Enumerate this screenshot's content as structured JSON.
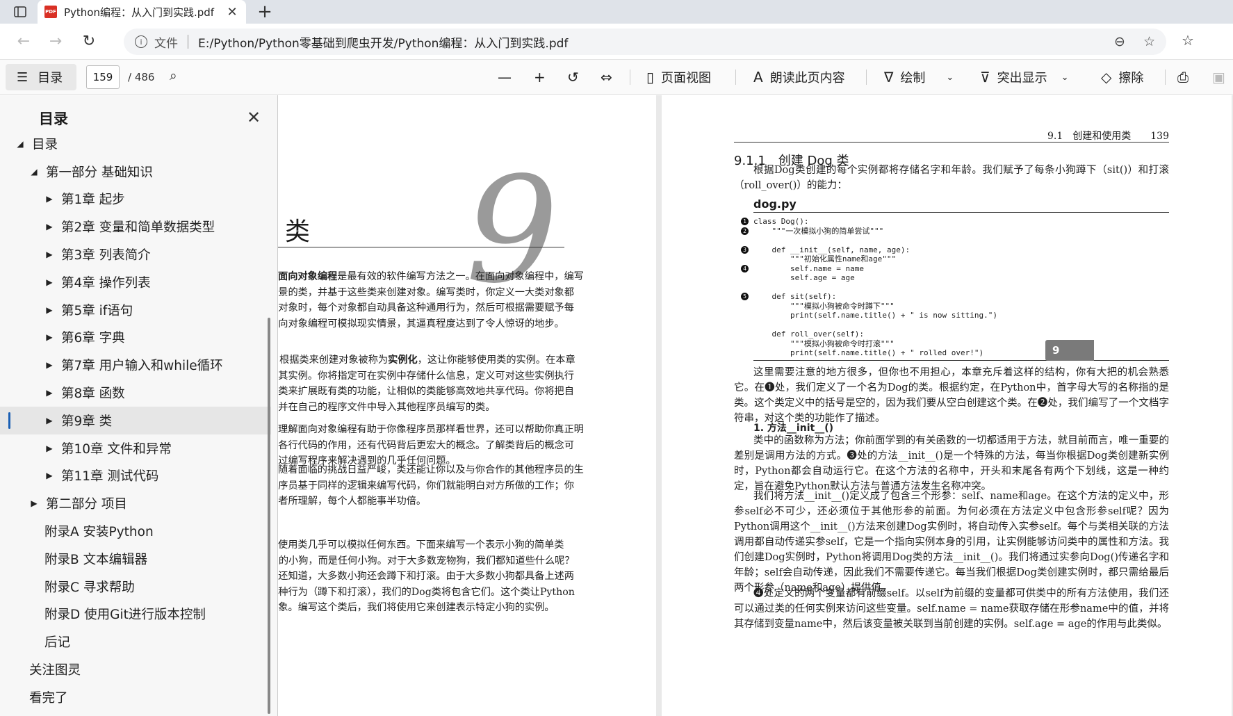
{
  "browser": {
    "tab_title": "Python编程：从入门到实践.pdf",
    "pdf_badge": "PDF",
    "scheme_label": "文件",
    "url": "E:/Python/Python零基础到爬虫开发/Python编程：从入门到实践.pdf"
  },
  "toolbar": {
    "toc_label": "目录",
    "page_current": "159",
    "page_total": "/ 486",
    "page_view_label": "页面视图",
    "read_aloud_label": "朗读此页内容",
    "draw_label": "绘制",
    "highlight_label": "突出显示",
    "erase_label": "擦除"
  },
  "sidebar": {
    "title": "目录",
    "items": [
      {
        "label": "目录",
        "tri": "◢"
      },
      {
        "label": "第一部分 基础知识",
        "tri": "◢"
      },
      {
        "label": "第1章 起步",
        "tri": "▶"
      },
      {
        "label": "第2章 变量和简单数据类型",
        "tri": "▶"
      },
      {
        "label": "第3章 列表简介",
        "tri": "▶"
      },
      {
        "label": "第4章 操作列表",
        "tri": "▶"
      },
      {
        "label": "第5章 if语句",
        "tri": "▶"
      },
      {
        "label": "第6章 字典",
        "tri": "▶"
      },
      {
        "label": "第7章 用户输入和while循环",
        "tri": "▶"
      },
      {
        "label": "第8章 函数",
        "tri": "▶"
      },
      {
        "label": "第9章 类",
        "tri": "▶"
      },
      {
        "label": "第10章 文件和异常",
        "tri": "▶"
      },
      {
        "label": "第11章 测试代码",
        "tri": "▶"
      },
      {
        "label": "第二部分 项目",
        "tri": "▶"
      },
      {
        "label": "附录A 安装Python",
        "tri": ""
      },
      {
        "label": "附录B 文本编辑器",
        "tri": ""
      },
      {
        "label": "附录C 寻求帮助",
        "tri": ""
      },
      {
        "label": "附录D 使用Git进行版本控制",
        "tri": ""
      },
      {
        "label": "后记",
        "tri": ""
      },
      {
        "label": "关注图灵",
        "tri": ""
      },
      {
        "label": "看完了",
        "tri": ""
      }
    ]
  },
  "left_page": {
    "chapter_number": "9",
    "chapter_title": "类",
    "para1_bold": "面向对象编程",
    "para1": "是最有效的软件编写方法之一。在面向对象编程中，编写表示现实世界中的事物和情景的类，并基于这些类来创建对象。编写类时，你定义一大类对象都有的通用行为。基于类创建对象时，每个对象都自动具备这种通用行为，然后可根据需要赋予每个对象独特的个性。使用面向对象编程可模拟现实情景，其逼真程度达到了令人惊讶的地步。",
    "para2_pre": "根据类来创建对象被称为",
    "para2_bold": "实例化",
    "para2": "，这让你能够使用类的实例。在本章中，你将编写一些类并创建其实例。你将指定可在实例中存储什么信息，定义可对这些实例执行哪些操作。你还将编写一些类来扩展既有类的功能，让相似的类能够高效地共享代码。你将把自己编写的类存储在模块中，并在自己的程序文件中导入其他程序员编写的类。",
    "para3": "理解面向对象编程有助于你像程序员那样看世界，还可以帮助你真正明白自己编写的代码：不仅是各行代码的作用，还有代码背后更宏大的概念。了解类背后的概念可培养逻辑思维，让你能够通过编写程序来解决遇到的几乎任何问题。",
    "para4": "随着面临的挑战日益严峻，类还能让你以及与你合作的其他程序员的生活更轻松。如果你与其他程序员基于同样的逻辑来编写代码，你们就能明白对方所做的工作；你编写的程序将能被众多合作者所理解，每个人都能事半功倍。",
    "para5": "使用类几乎可以模拟任何东西。下面来编写一个表示小狗的简单类Dog——它表示的不是特定的小狗，而是任何小狗。对于大多数宠物狗，我们都知道些什么呢？它们都有名字和年龄；我们还知道，大多数小狗还会蹲下和打滚。由于大多数小狗都具备上述两项信息（名字和年龄）和两种行为（蹲下和打滚），我们的Dog类将包含它们。这个类让Python知道如何创建表示小狗的对象。编写这个类后，我们将使用它来创建表示特定小狗的实例。"
  },
  "right_page": {
    "running_head": "9.1　创建和使用类　　139",
    "section_heading": "9.1.1　创建 Dog 类",
    "intro": "根据Dog类创建的每个实例都将存储名字和年龄。我们赋予了每条小狗蹲下（sit()）和打滚（roll_over()）的能力：",
    "code_filename": "dog.py",
    "code_lines": [
      {
        "mark": "1",
        "text": "class Dog():"
      },
      {
        "mark": "2",
        "text": "    \"\"\"一次模拟小狗的简单尝试\"\"\""
      },
      {
        "mark": "",
        "text": ""
      },
      {
        "mark": "3",
        "text": "    def __init__(self, name, age):"
      },
      {
        "mark": "",
        "text": "        \"\"\"初始化属性name和age\"\"\""
      },
      {
        "mark": "4",
        "text": "        self.name = name"
      },
      {
        "mark": "",
        "text": "        self.age = age"
      },
      {
        "mark": "",
        "text": ""
      },
      {
        "mark": "5",
        "text": "    def sit(self):"
      },
      {
        "mark": "",
        "text": "        \"\"\"模拟小狗被命令时蹲下\"\"\""
      },
      {
        "mark": "",
        "text": "        print(self.name.title() + \" is now sitting.\")"
      },
      {
        "mark": "",
        "text": ""
      },
      {
        "mark": "",
        "text": "    def roll_over(self):"
      },
      {
        "mark": "",
        "text": "        \"\"\"模拟小狗被命令时打滚\"\"\""
      },
      {
        "mark": "",
        "text": "        print(self.name.title() + \" rolled over!\")"
      }
    ],
    "para_after_code": "这里需要注意的地方很多，但你也不用担心，本章充斥着这样的结构，你有大把的机会熟悉它。在❶处，我们定义了一个名为Dog的类。根据约定，在Python中，首字母大写的名称指的是类。这个类定义中的括号是空的，因为我们要从空白创建这个类。在❷处，我们编写了一个文档字符串，对这个类的功能作了描述。",
    "subhead": "1. 方法__init__()",
    "para_method1": "类中的函数称为方法；你前面学到的有关函数的一切都适用于方法，就目前而言，唯一重要的差别是调用方法的方式。❸处的方法__init__()是一个特殊的方法，每当你根据Dog类创建新实例时，Python都会自动运行它。在这个方法的名称中，开头和末尾各有两个下划线，这是一种约定，旨在避免Python默认方法与普通方法发生名称冲突。",
    "para_method2": "我们将方法__init__()定义成了包含三个形参：self、name和age。在这个方法的定义中，形参self必不可少，还必须位于其他形参的前面。为何必须在方法定义中包含形参self呢？因为Python调用这个__init__()方法来创建Dog实例时，将自动传入实参self。每个与类相关联的方法调用都自动传递实参self，它是一个指向实例本身的引用，让实例能够访问类中的属性和方法。我们创建Dog实例时，Python将调用Dog类的方法__init__()。我们将通过实参向Dog()传递名字和年龄；self会自动传递，因此我们不需要传递它。每当我们根据Dog类创建实例时，都只需给最后两个形参（name和age）提供值。",
    "para_method3": "❹处定义的两个变量都有前缀self。以self为前缀的变量都可供类中的所有方法使用，我们还可以通过类的任何实例来访问这些变量。self.name = name获取存储在形参name中的值，并将其存储到变量name中，然后该变量被关联到当前创建的实例。self.age = age的作用与此类似。",
    "chapter_tab": "9"
  }
}
